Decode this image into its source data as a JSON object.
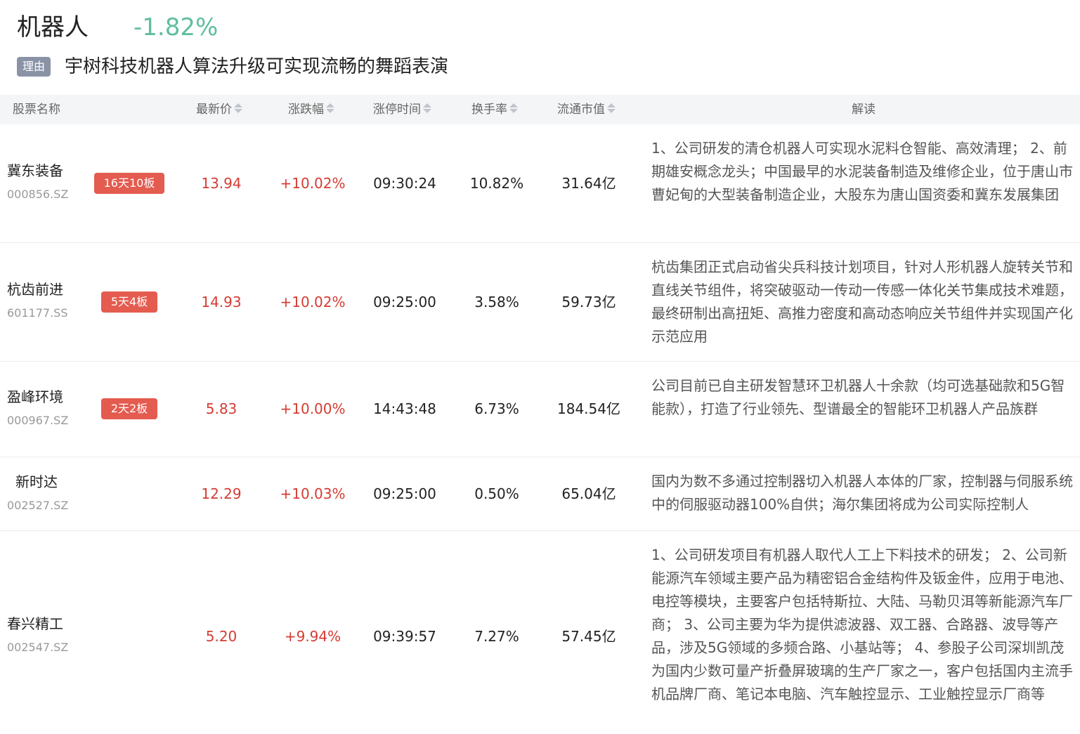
{
  "sector": {
    "name": "机器人",
    "change": "-1.82%",
    "change_color": "#5fbe9f"
  },
  "reason": {
    "badge": "理由",
    "text": "宇树科技机器人算法升级可实现流畅的舞蹈表演"
  },
  "columns": {
    "name": "股票名称",
    "price": "最新价",
    "change": "涨跌幅",
    "limit_time": "涨停时间",
    "turnover": "换手率",
    "market_cap": "流通市值",
    "explain": "解读"
  },
  "colors": {
    "up": "#d43c33",
    "badge": "#e45b4f",
    "header_bg": "#f4f5f7"
  },
  "rows": [
    {
      "name": "冀东装备",
      "code": "000856.SZ",
      "badge": "16天10板",
      "price": "13.94",
      "change": "+10.02%",
      "limit_time": "09:30:24",
      "turnover": "10.82%",
      "market_cap": "31.64亿",
      "explain": "1、公司研发的清仓机器人可实现水泥料仓智能、高效清理； 2、前期雄安概念龙头；中国最早的水泥装备制造及维修企业，位于唐山市曹妃甸的大型装备制造企业，大股东为唐山国资委和冀东发展集团"
    },
    {
      "name": "杭齿前进",
      "code": "601177.SS",
      "badge": "5天4板",
      "price": "14.93",
      "change": "+10.02%",
      "limit_time": "09:25:00",
      "turnover": "3.58%",
      "market_cap": "59.73亿",
      "explain": "杭齿集团正式启动省尖兵科技计划项目，针对人形机器人旋转关节和直线关节组件，将突破驱动一传动一传感一体化关节集成技术难题，最终研制出高扭矩、高推力密度和高动态响应关节组件并实现国产化示范应用"
    },
    {
      "name": "盈峰环境",
      "code": "000967.SZ",
      "badge": "2天2板",
      "price": "5.83",
      "change": "+10.00%",
      "limit_time": "14:43:48",
      "turnover": "6.73%",
      "market_cap": "184.54亿",
      "explain": "公司目前已自主研发智慧环卫机器人十余款（均可选基础款和5G智能款），打造了行业领先、型谱最全的智能环卫机器人产品族群"
    },
    {
      "name": "新时达",
      "code": "002527.SZ",
      "badge": "",
      "price": "12.29",
      "change": "+10.03%",
      "limit_time": "09:25:00",
      "turnover": "0.50%",
      "market_cap": "65.04亿",
      "explain": "国内为数不多通过控制器切入机器人本体的厂家，控制器与伺服系统中的伺服驱动器100%自供；海尔集团将成为公司实际控制人"
    },
    {
      "name": "春兴精工",
      "code": "002547.SZ",
      "badge": "",
      "price": "5.20",
      "change": "+9.94%",
      "limit_time": "09:39:57",
      "turnover": "7.27%",
      "market_cap": "57.45亿",
      "explain": "1、公司研发项目有机器人取代人工上下料技术的研发； 2、公司新能源汽车领域主要产品为精密铝合金结构件及钣金件，应用于电池、电控等模块，主要客户包括特斯拉、大陆、马勒贝洱等新能源汽车厂商； 3、公司主要为华为提供滤波器、双工器、合路器、波导等产品，涉及5G领域的多频合路、小基站等； 4、参股子公司深圳凯茂为国内少数可量产折叠屏玻璃的生产厂家之一，客户包括国内主流手机品牌厂商、笔记本电脑、汽车触控显示、工业触控显示厂商等"
    }
  ]
}
